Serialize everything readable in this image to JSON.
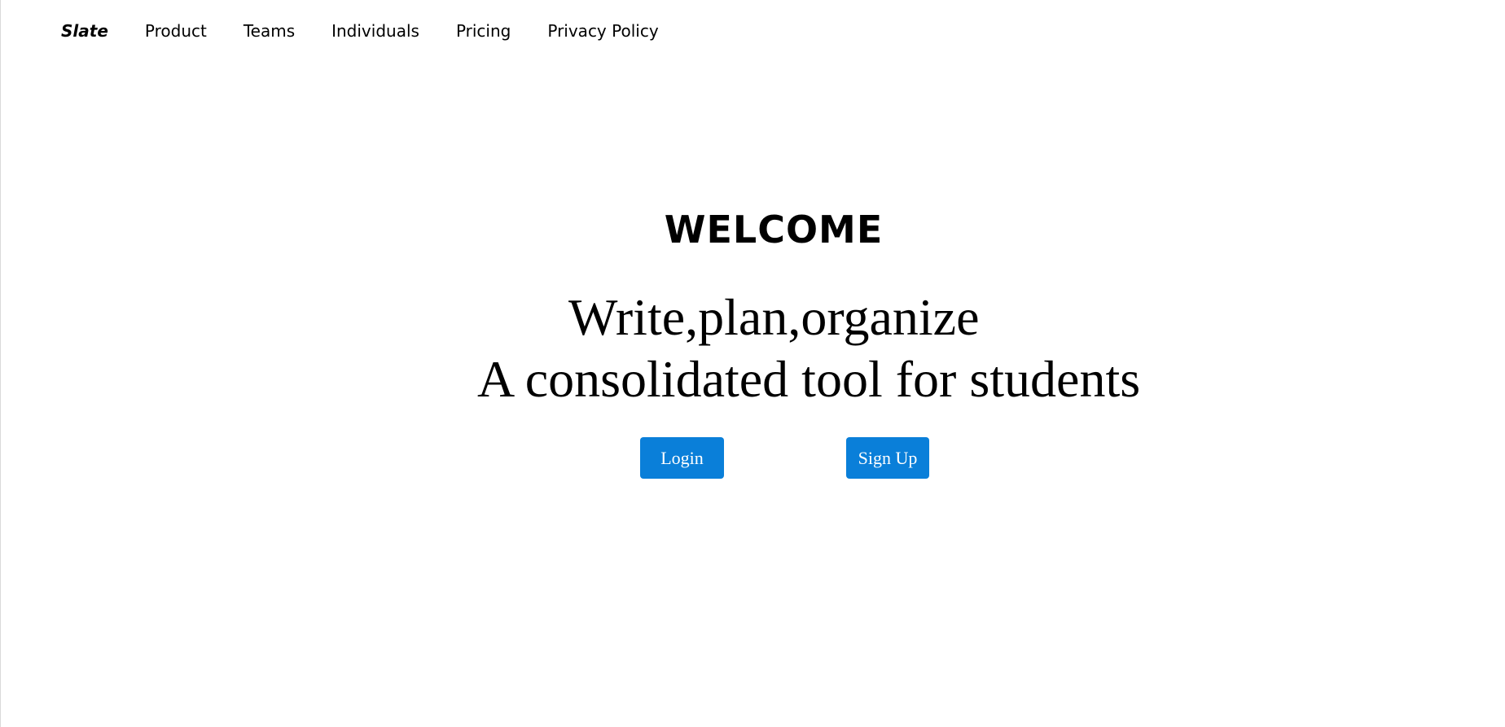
{
  "nav": {
    "brand": "Slate",
    "links": [
      "Product",
      "Teams",
      "Individuals",
      "Pricing",
      "Privacy Policy"
    ]
  },
  "hero": {
    "title": "WELCOME",
    "subtitle_line1": "Write,plan,organize",
    "subtitle_line2": "A consolidated tool for students"
  },
  "actions": {
    "login_label": "Login",
    "signup_label": "Sign Up"
  },
  "colors": {
    "button_bg": "#0a7fd9",
    "button_text": "#ffffff",
    "text": "#000000",
    "background": "#ffffff"
  }
}
